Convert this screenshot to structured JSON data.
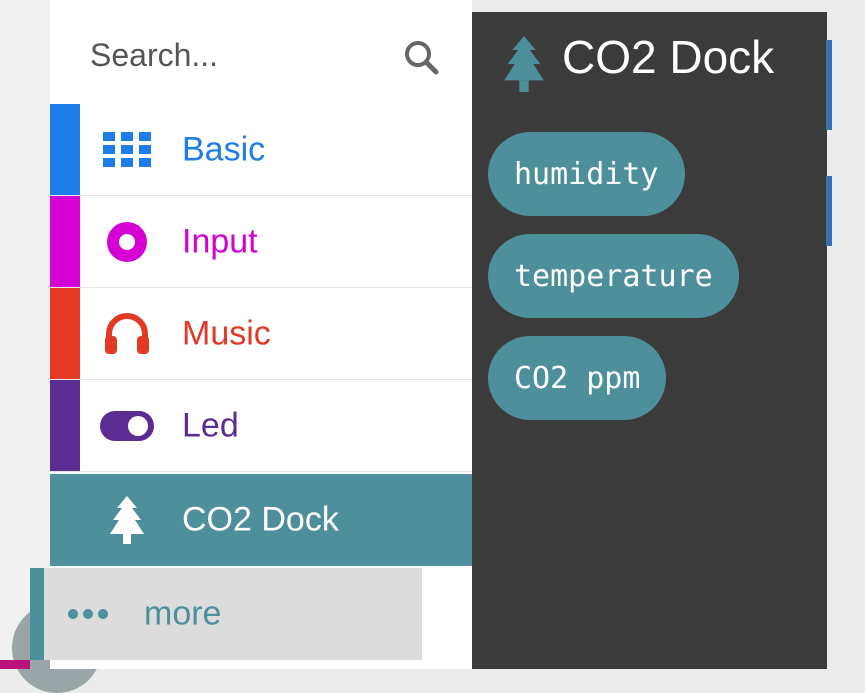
{
  "search": {
    "placeholder": "Search..."
  },
  "categories": [
    {
      "label": "Basic",
      "color": "#1e7de8",
      "icon": "grid-icon"
    },
    {
      "label": "Input",
      "color": "#d400d4",
      "icon": "target-icon"
    },
    {
      "label": "Music",
      "color": "#e33824",
      "icon": "headphones-icon"
    },
    {
      "label": "Led",
      "color": "#5b2c91",
      "icon": "toggle-icon"
    },
    {
      "label": "CO2 Dock",
      "color": "#4e8f9c",
      "icon": "tree-icon",
      "selected": true
    }
  ],
  "more": {
    "label": "more",
    "icon": "ellipsis-icon"
  },
  "flyout": {
    "title": "CO2 Dock",
    "icon": "tree-icon",
    "blocks": [
      {
        "label": "humidity"
      },
      {
        "label": "temperature"
      },
      {
        "label": "CO2 ppm"
      }
    ]
  }
}
